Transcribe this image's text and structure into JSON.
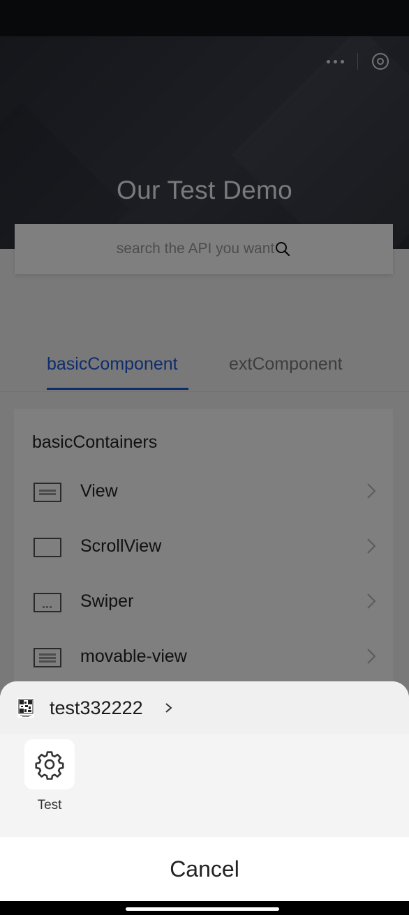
{
  "app": {
    "title": "Our Test Demo"
  },
  "search": {
    "placeholder": "search the API you want"
  },
  "tabs": [
    {
      "label": "basicComponent",
      "active": true
    },
    {
      "label": "extComponent",
      "active": false
    }
  ],
  "section": {
    "title": "basicContainers",
    "items": [
      {
        "label": "View",
        "icon": "view-icon"
      },
      {
        "label": "ScrollView",
        "icon": "scroll-view-icon"
      },
      {
        "label": "Swiper",
        "icon": "swiper-icon"
      },
      {
        "label": "movable-view",
        "icon": "movable-view-icon"
      }
    ]
  },
  "sheet": {
    "app_name": "test332222",
    "actions": [
      {
        "label": "Test",
        "icon": "gear-icon"
      }
    ],
    "cancel_label": "Cancel"
  },
  "colors": {
    "accent": "#1e5bd8",
    "hero": "#2f3139",
    "overlay": "rgba(0,0,0,0.5)"
  }
}
